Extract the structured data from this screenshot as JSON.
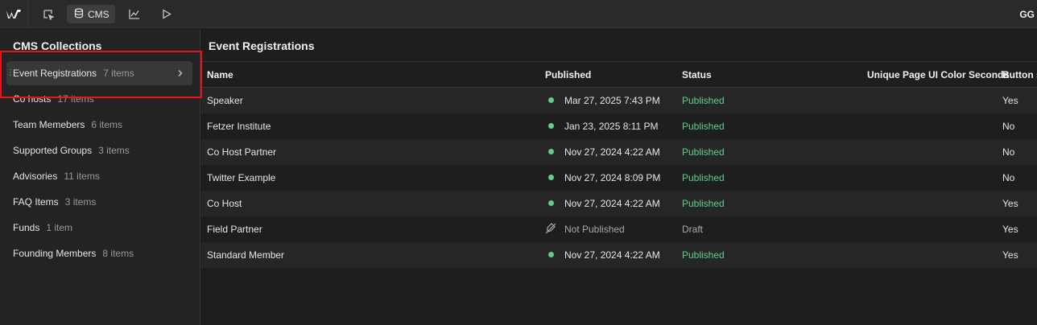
{
  "topbar": {
    "cms_label": "CMS",
    "user_initials": "GG",
    "icons": [
      "webflow-logo-icon",
      "select-cursor-icon",
      "database-icon",
      "analytics-chart-icon",
      "play-preview-icon"
    ]
  },
  "sidebar": {
    "title": "CMS Collections",
    "items": [
      {
        "name": "Event Registrations",
        "count": "7 items"
      },
      {
        "name": "Co hosts",
        "count": "17 items"
      },
      {
        "name": "Team Memebers",
        "count": "6 items"
      },
      {
        "name": "Supported Groups",
        "count": "3 items"
      },
      {
        "name": "Advisories",
        "count": "11 items"
      },
      {
        "name": "FAQ Items",
        "count": "3 items"
      },
      {
        "name": "Funds",
        "count": "1 item"
      },
      {
        "name": "Founding Members",
        "count": "8 items"
      }
    ]
  },
  "main": {
    "title": "Event Registrations",
    "columns": [
      "Name",
      "Published",
      "Status",
      "Unique Page UI Color Seconda",
      "Button s"
    ],
    "rows": [
      {
        "name": "Speaker",
        "published": "Mar 27, 2025 7:43 PM",
        "status": "Published",
        "button": "Yes"
      },
      {
        "name": "Fetzer Institute",
        "published": "Jan 23, 2025 8:11 PM",
        "status": "Published",
        "button": "No"
      },
      {
        "name": "Co Host Partner",
        "published": "Nov 27, 2024 4:22 AM",
        "status": "Published",
        "button": "No"
      },
      {
        "name": "Twitter Example",
        "published": "Nov 27, 2024 8:09 PM",
        "status": "Published",
        "button": "No"
      },
      {
        "name": "Co Host",
        "published": "Nov 27, 2024 4:22 AM",
        "status": "Published",
        "button": "Yes"
      },
      {
        "name": "Field Partner",
        "published": "Not Published",
        "status": "Draft",
        "button": "Yes"
      },
      {
        "name": "Standard Member",
        "published": "Nov 27, 2024 4:22 AM",
        "status": "Published",
        "button": "Yes"
      }
    ]
  },
  "colors": {
    "accent_green": "#5fd08b",
    "highlight_red": "#e8141a"
  }
}
